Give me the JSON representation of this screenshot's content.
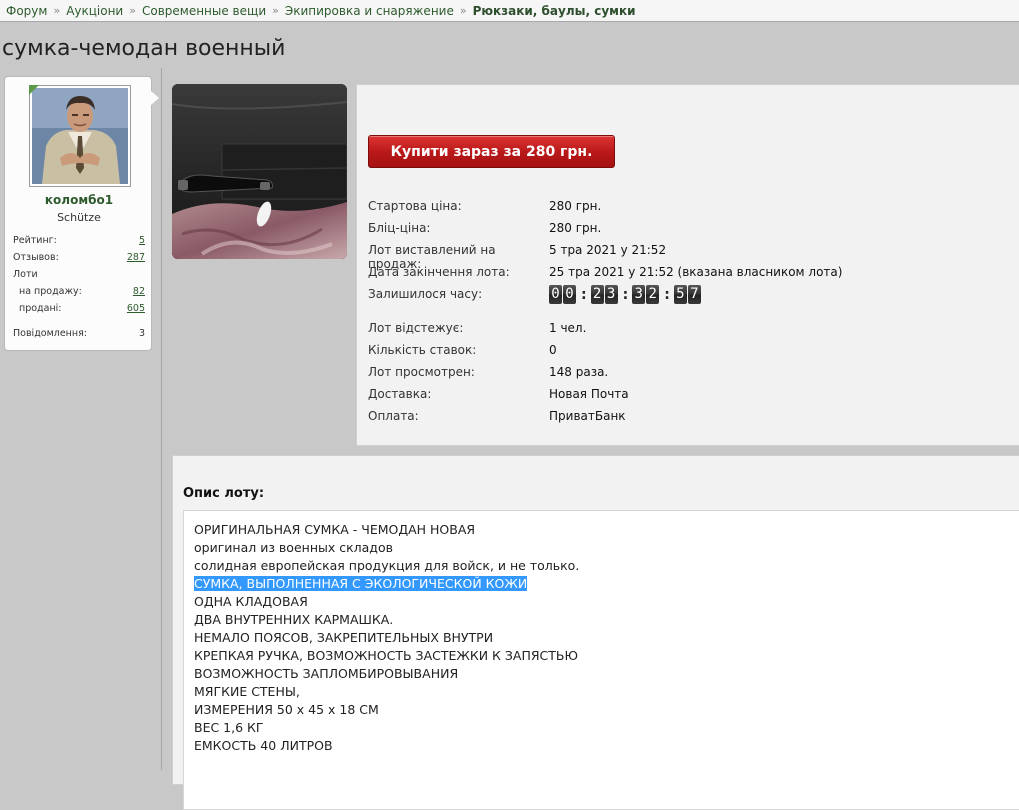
{
  "breadcrumb": {
    "items": [
      "Форум",
      "Аукціони",
      "Современные вещи",
      "Экипировка и снаряжение"
    ],
    "current": "Рюкзаки, баулы, сумки",
    "separator": "»"
  },
  "page_title": "сумка-чемодан военный",
  "user": {
    "name": "коломбо1",
    "rank": "Schütze",
    "stats": {
      "rating_label": "Рейтинг:",
      "rating": "5",
      "reviews_label": "Отзывов:",
      "reviews": "287",
      "lots_label": "Лоти",
      "for_sale_label": "на продажу:",
      "for_sale": "82",
      "sold_label": "продані:",
      "sold": "605",
      "messages_label": "Повідомлення:",
      "messages": "3"
    }
  },
  "lot": {
    "buy_button": "Купити зараз за 280 грн.",
    "rows": {
      "start_price": {
        "label": "Стартова ціна:",
        "value": "280 грн."
      },
      "blitz_price": {
        "label": "Бліц-ціна:",
        "value": "280 грн."
      },
      "listed": {
        "label": "Лот виставлений на продаж:",
        "value": "5 тра 2021 у 21:52"
      },
      "end_date": {
        "label": "Дата закінчення лота:",
        "value": "25 тра 2021 у 21:52 (вказана власником лота)"
      },
      "time_left": {
        "label": "Залишилося часу:"
      },
      "watching": {
        "label": "Лот відстежує:",
        "value": "1 чел."
      },
      "bids": {
        "label": "Кількість ставок:",
        "value": "0"
      },
      "views": {
        "label": "Лот просмотрен:",
        "value": "148 раза."
      },
      "delivery": {
        "label": "Доставка:",
        "value": "Новая Почта"
      },
      "payment": {
        "label": "Оплата:",
        "value": "ПриватБанк"
      }
    },
    "countdown": {
      "d": "00",
      "h": "23",
      "m": "32",
      "s": "57"
    }
  },
  "description": {
    "title": "Опис лоту:",
    "lines": [
      "ОРИГИНАЛЬНАЯ СУМКА - ЧЕМОДАН НОВАЯ",
      "оригинал из военных складов",
      "солидная европейская продукция для войск, и не только.",
      "СУМКА, ВЫПОЛНЕННАЯ С ЭКОЛОГИЧЕСКОЙ КОЖИ",
      "ОДНА КЛАДОВАЯ",
      "ДВА ВНУТРЕННИХ КАРМАШКА.",
      "НЕМАЛО ПОЯСОВ, ЗАКРЕПИТЕЛЬНЫХ ВНУТРИ",
      "КРЕПКАЯ РУЧКА, ВОЗМОЖНОСТЬ ЗАСТЕЖКИ К ЗАПЯСТЬЮ",
      "ВОЗМОЖНОСТЬ ЗАПЛОМБИРОВЫВАНИЯ",
      "МЯГКИЕ СТЕНЫ,",
      "ИЗМЕРЕНИЯ 50 х 45 х 18 СМ",
      "ВЕС 1,6 КГ",
      "ЕМКОСТЬ 40 ЛИТРОВ"
    ]
  },
  "colors": {
    "accent_green": "#2e5b2e",
    "buy_red": "#c11f1f",
    "selection": "#3399ff"
  }
}
